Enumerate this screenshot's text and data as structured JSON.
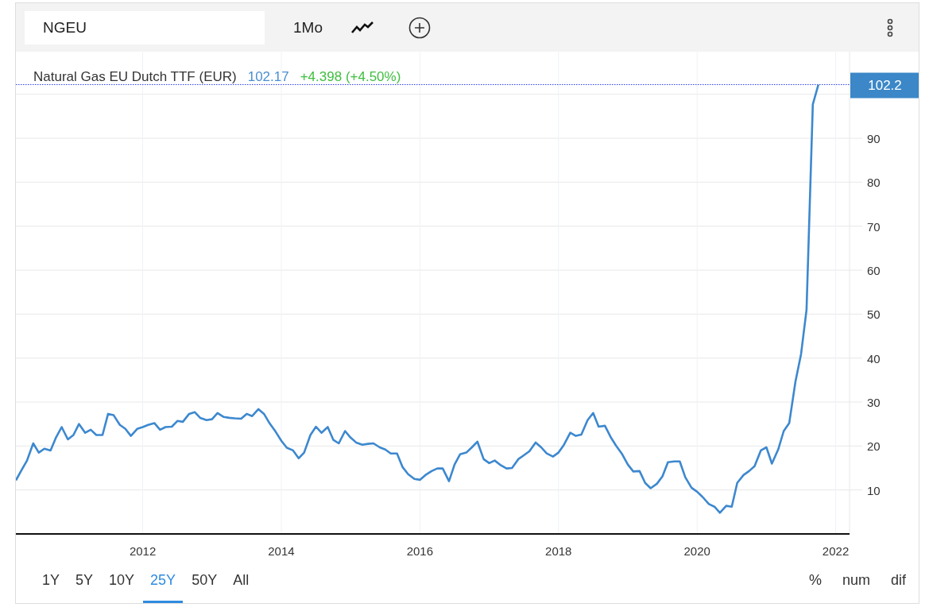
{
  "toolbar": {
    "symbol": "NGEU",
    "interval": "1Mo"
  },
  "legend": {
    "price": "102.17",
    "change": "+4.398 (+4.50%)"
  },
  "price_tag": "102.2",
  "chart_data": {
    "type": "line",
    "grid": true,
    "xlim": [
      2010.17,
      2022.2
    ],
    "ylim": [
      0,
      109.7
    ],
    "xticks": [
      2012,
      2014,
      2016,
      2018,
      2020,
      2022
    ],
    "yticks": [
      10,
      20,
      30,
      40,
      50,
      60,
      70,
      80,
      90
    ],
    "ref_lines": [
      {
        "axis": "y",
        "value": 102.2,
        "color": "#3344ee"
      }
    ],
    "x": [
      2010.17,
      2010.25,
      2010.33,
      2010.42,
      2010.5,
      2010.58,
      2010.67,
      2010.75,
      2010.83,
      2010.92,
      2011,
      2011.08,
      2011.17,
      2011.25,
      2011.33,
      2011.42,
      2011.5,
      2011.58,
      2011.67,
      2011.75,
      2011.83,
      2011.92,
      2012,
      2012.08,
      2012.17,
      2012.25,
      2012.33,
      2012.42,
      2012.5,
      2012.58,
      2012.67,
      2012.75,
      2012.83,
      2012.92,
      2013,
      2013.08,
      2013.17,
      2013.25,
      2013.33,
      2013.42,
      2013.5,
      2013.58,
      2013.67,
      2013.75,
      2013.83,
      2013.92,
      2014,
      2014.08,
      2014.17,
      2014.25,
      2014.33,
      2014.42,
      2014.5,
      2014.58,
      2014.67,
      2014.75,
      2014.83,
      2014.92,
      2015,
      2015.08,
      2015.17,
      2015.25,
      2015.33,
      2015.42,
      2015.5,
      2015.58,
      2015.67,
      2015.75,
      2015.83,
      2015.92,
      2016,
      2016.08,
      2016.17,
      2016.25,
      2016.33,
      2016.42,
      2016.5,
      2016.58,
      2016.67,
      2016.75,
      2016.83,
      2016.92,
      2017,
      2017.08,
      2017.17,
      2017.25,
      2017.33,
      2017.42,
      2017.5,
      2017.58,
      2017.67,
      2017.75,
      2017.83,
      2017.92,
      2018,
      2018.08,
      2018.17,
      2018.25,
      2018.33,
      2018.42,
      2018.5,
      2018.58,
      2018.67,
      2018.75,
      2018.83,
      2018.92,
      2019,
      2019.08,
      2019.17,
      2019.25,
      2019.33,
      2019.42,
      2019.5,
      2019.58,
      2019.67,
      2019.75,
      2019.83,
      2019.92,
      2020,
      2020.08,
      2020.17,
      2020.25,
      2020.33,
      2020.42,
      2020.5,
      2020.58,
      2020.67,
      2020.75,
      2020.83,
      2020.92,
      2021,
      2021.08,
      2021.17,
      2021.25,
      2021.33,
      2021.42,
      2021.5,
      2021.58,
      2021.67,
      2021.75
    ],
    "series": [
      {
        "name": "Natural Gas EU Dutch TTF (EUR)",
        "color": "#3d88cf",
        "values": [
          12.2,
          14.5,
          16.7,
          20.6,
          18.5,
          19.4,
          19.0,
          22.0,
          24.3,
          21.5,
          22.5,
          25.0,
          23.0,
          23.7,
          22.5,
          22.5,
          27.3,
          27.0,
          24.8,
          23.9,
          22.3,
          23.9,
          24.3,
          24.8,
          25.2,
          23.7,
          24.3,
          24.4,
          25.7,
          25.5,
          27.3,
          27.7,
          26.4,
          25.9,
          26.1,
          27.5,
          26.6,
          26.4,
          26.3,
          26.2,
          27.3,
          26.8,
          28.4,
          27.3,
          25.2,
          23.2,
          21.2,
          19.6,
          19.0,
          17.2,
          18.5,
          22.5,
          24.4,
          23.0,
          24.3,
          21.4,
          20.6,
          23.4,
          21.9,
          20.8,
          20.3,
          20.5,
          20.6,
          19.7,
          19.2,
          18.3,
          18.3,
          15.2,
          13.6,
          12.5,
          12.3,
          13.4,
          14.3,
          14.9,
          14.9,
          12.0,
          15.8,
          18.1,
          18.5,
          19.7,
          21.0,
          17.0,
          16.1,
          16.7,
          15.6,
          14.9,
          15.0,
          17.0,
          17.9,
          18.8,
          20.8,
          19.7,
          18.3,
          17.6,
          18.5,
          20.3,
          23.0,
          22.3,
          22.6,
          25.9,
          27.5,
          24.4,
          24.6,
          22.1,
          20.1,
          18.1,
          15.8,
          14.2,
          14.3,
          11.6,
          10.4,
          11.4,
          13.1,
          16.3,
          16.5,
          16.5,
          12.9,
          10.5,
          9.6,
          8.4,
          6.8,
          6.2,
          4.8,
          6.4,
          6.2,
          11.6,
          13.4,
          14.3,
          15.4,
          19.0,
          19.7,
          16.0,
          19.2,
          23.4,
          25.2,
          34.7,
          40.9,
          51.0,
          97.7,
          102.2
        ]
      }
    ]
  },
  "ranges": [
    {
      "label": "1Y",
      "selected": false
    },
    {
      "label": "5Y",
      "selected": false
    },
    {
      "label": "10Y",
      "selected": false
    },
    {
      "label": "25Y",
      "selected": true
    },
    {
      "label": "50Y",
      "selected": false
    },
    {
      "label": "All",
      "selected": false
    }
  ],
  "modes": [
    "%",
    "num",
    "dif"
  ]
}
